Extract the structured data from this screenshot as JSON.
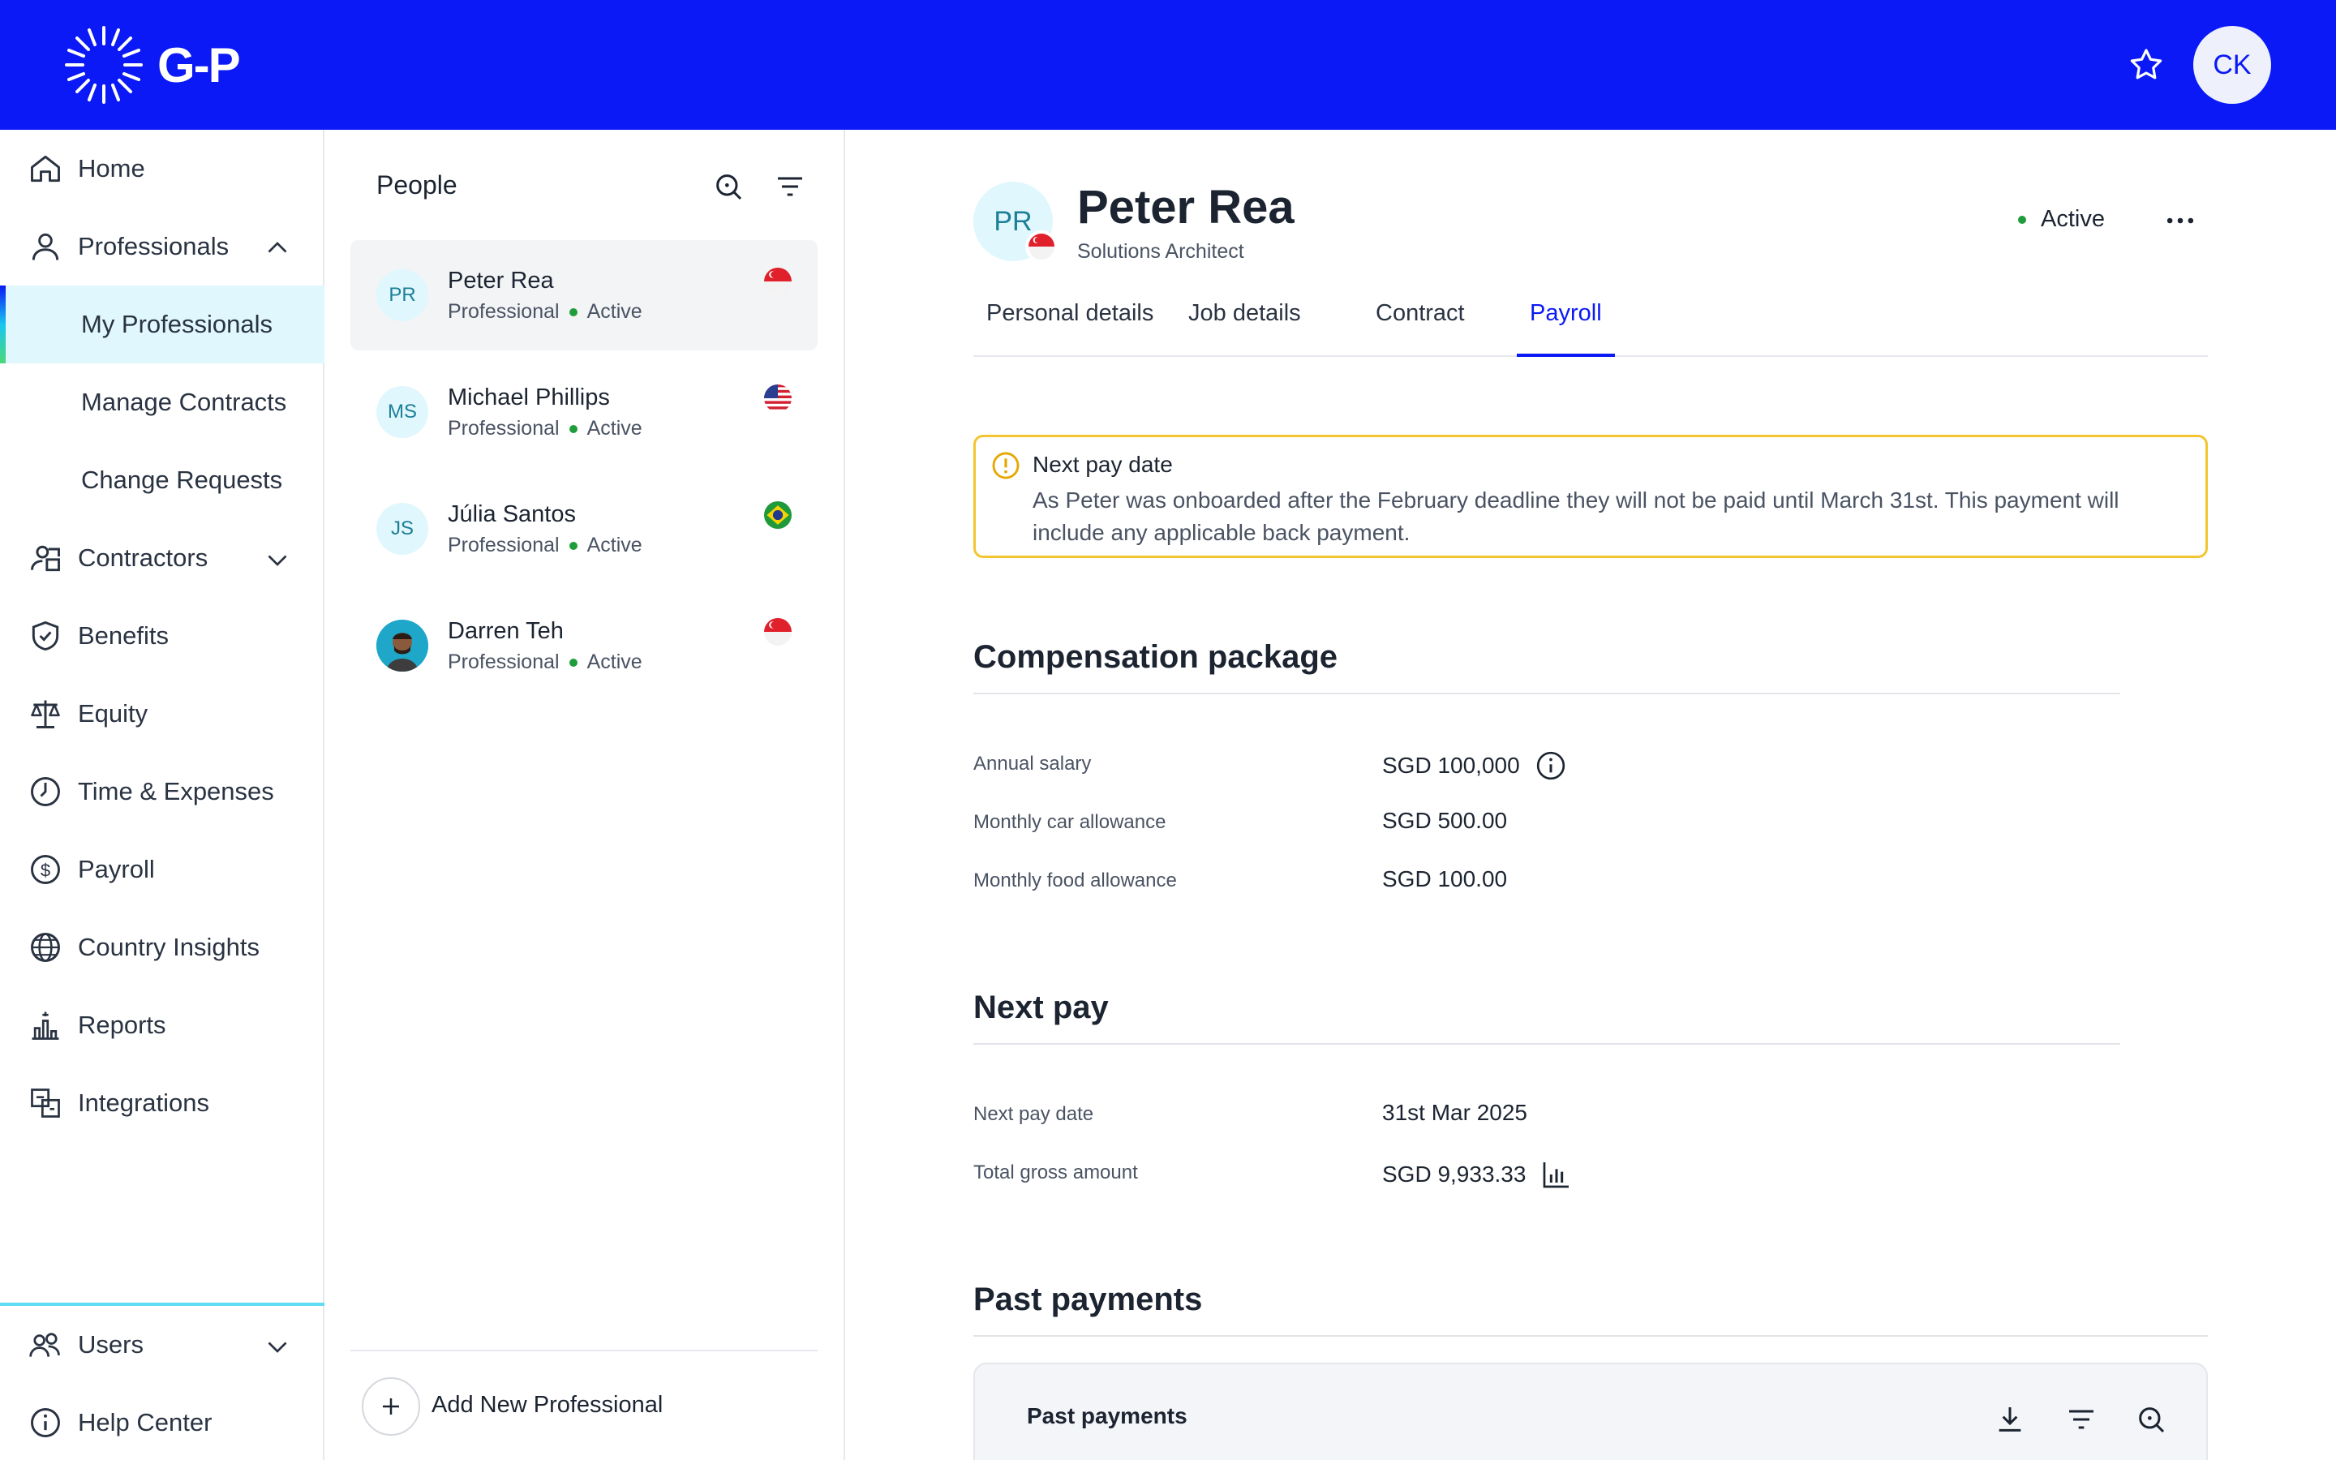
{
  "brand": {
    "logo_text": "G-P",
    "accent": "#0a19f5"
  },
  "header": {
    "favorite_icon": "star-icon",
    "user_initials": "CK"
  },
  "sidebar": {
    "items": [
      {
        "label": "Home",
        "icon": "home-icon"
      },
      {
        "label": "Professionals",
        "icon": "person-icon",
        "expanded": true
      },
      {
        "label": "My Professionals",
        "active": true
      },
      {
        "label": "Manage Contracts"
      },
      {
        "label": "Change Requests"
      },
      {
        "label": "Contractors",
        "icon": "contractors-icon",
        "expanded": false
      },
      {
        "label": "Benefits",
        "icon": "shield-icon"
      },
      {
        "label": "Equity",
        "icon": "scale-icon"
      },
      {
        "label": "Time & Expenses",
        "icon": "clock-icon"
      },
      {
        "label": "Payroll",
        "icon": "dollar-icon"
      },
      {
        "label": "Country Insights",
        "icon": "globe-icon"
      },
      {
        "label": "Reports",
        "icon": "reports-icon"
      },
      {
        "label": "Integrations",
        "icon": "integrations-icon"
      }
    ],
    "footer": [
      {
        "label": "Users",
        "icon": "users-icon"
      },
      {
        "label": "Help Center",
        "icon": "info-icon"
      }
    ]
  },
  "people": {
    "title": "People",
    "list": [
      {
        "initials": "PR",
        "name": "Peter Rea",
        "role": "Professional",
        "status": "Active",
        "flag": "singapore-flag"
      },
      {
        "initials": "MS",
        "name": "Michael Phillips",
        "role": "Professional",
        "status": "Active",
        "flag": "usa-flag"
      },
      {
        "initials": "JS",
        "name": "Júlia Santos",
        "role": "Professional",
        "status": "Active",
        "flag": "brazil-flag"
      },
      {
        "initials": "",
        "name": "Darren Teh",
        "role": "Professional",
        "status": "Active",
        "flag": "singapore-flag"
      }
    ],
    "add_label": "Add New Professional"
  },
  "profile": {
    "initials": "PR",
    "name": "Peter Rea",
    "role": "Solutions Architect",
    "status": "Active",
    "tabs": [
      "Personal details",
      "Job details",
      "Contract",
      "Payroll"
    ],
    "active_tab": "Payroll"
  },
  "alert": {
    "title": "Next pay date",
    "body": "As Peter was onboarded after the February deadline they will not be paid until March 31st. This payment will include any applicable back payment."
  },
  "compensation": {
    "title": "Compensation package",
    "rows": [
      {
        "label": "Annual salary",
        "value": "SGD 100,000"
      },
      {
        "label": "Monthly car allowance",
        "value": "SGD 500.00"
      },
      {
        "label": "Monthly food allowance",
        "value": "SGD 100.00"
      }
    ]
  },
  "next_pay": {
    "title": "Next pay",
    "rows": [
      {
        "label": "Next pay date",
        "value": "31st Mar 2025"
      },
      {
        "label": "Total gross amount",
        "value": "SGD 9,933.33"
      }
    ]
  },
  "past_payments": {
    "title": "Past payments",
    "card_title": "Past payments"
  }
}
